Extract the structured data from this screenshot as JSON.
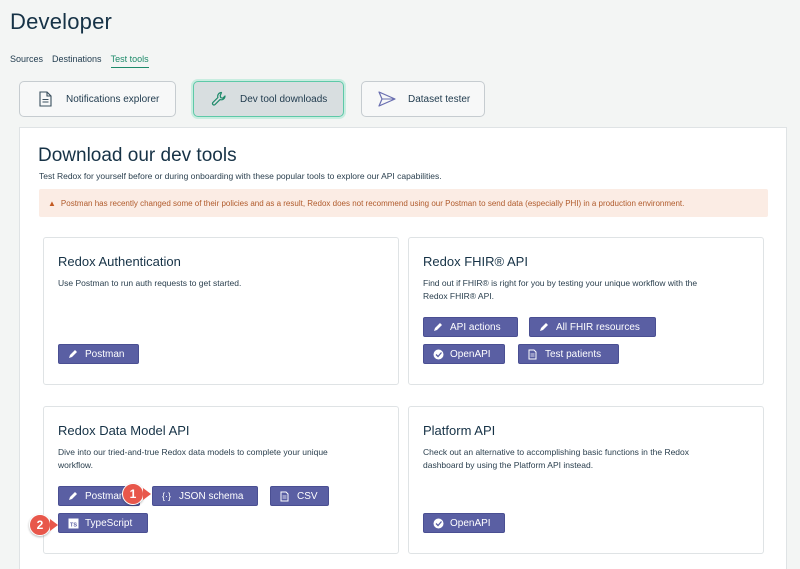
{
  "page": {
    "title": "Developer"
  },
  "tabs": [
    {
      "label": "Sources"
    },
    {
      "label": "Destinations"
    },
    {
      "label": "Test tools"
    }
  ],
  "tools": [
    {
      "label": "Notifications explorer",
      "icon": "document-icon"
    },
    {
      "label": "Dev tool downloads",
      "icon": "wrench-icon"
    },
    {
      "label": "Dataset tester",
      "icon": "send-icon"
    }
  ],
  "main": {
    "title": "Download our dev tools",
    "subtitle": "Test Redox for yourself before or during onboarding with these popular tools to explore our API capabilities.",
    "warning": "Postman has recently changed some of their policies and as a result, Redox does not recommend using our Postman to send data (especially PHI) in a production environment."
  },
  "cards": {
    "auth": {
      "title": "Redox Authentication",
      "desc": "Use Postman to run auth requests to get started.",
      "buttons": [
        "Postman"
      ]
    },
    "fhir": {
      "title": "Redox FHIR® API",
      "desc1": "Find out if FHIR® is right for you by testing your unique workflow with the",
      "desc2": "Redox FHIR® API.",
      "buttons": [
        "API actions",
        "All FHIR resources",
        "OpenAPI",
        "Test patients"
      ]
    },
    "datamodel": {
      "title": "Redox Data Model API",
      "desc1": "Dive into our tried-and-true Redox data models to complete your unique",
      "desc2": "workflow.",
      "buttons": [
        "Postman",
        "JSON schema",
        "CSV",
        "TypeScript"
      ]
    },
    "platform": {
      "title": "Platform API",
      "desc1": "Check out an alternative to accomplishing basic functions in the Redox",
      "desc2": "dashboard by using the Platform API instead.",
      "buttons": [
        "OpenAPI"
      ]
    }
  },
  "steps": [
    "1",
    "2"
  ],
  "colors": {
    "accent": "#1e8a6a",
    "button": "#5a5fa3",
    "warning_bg": "#fbece4",
    "warning_text": "#b05b2c",
    "step": "#e8574b"
  }
}
